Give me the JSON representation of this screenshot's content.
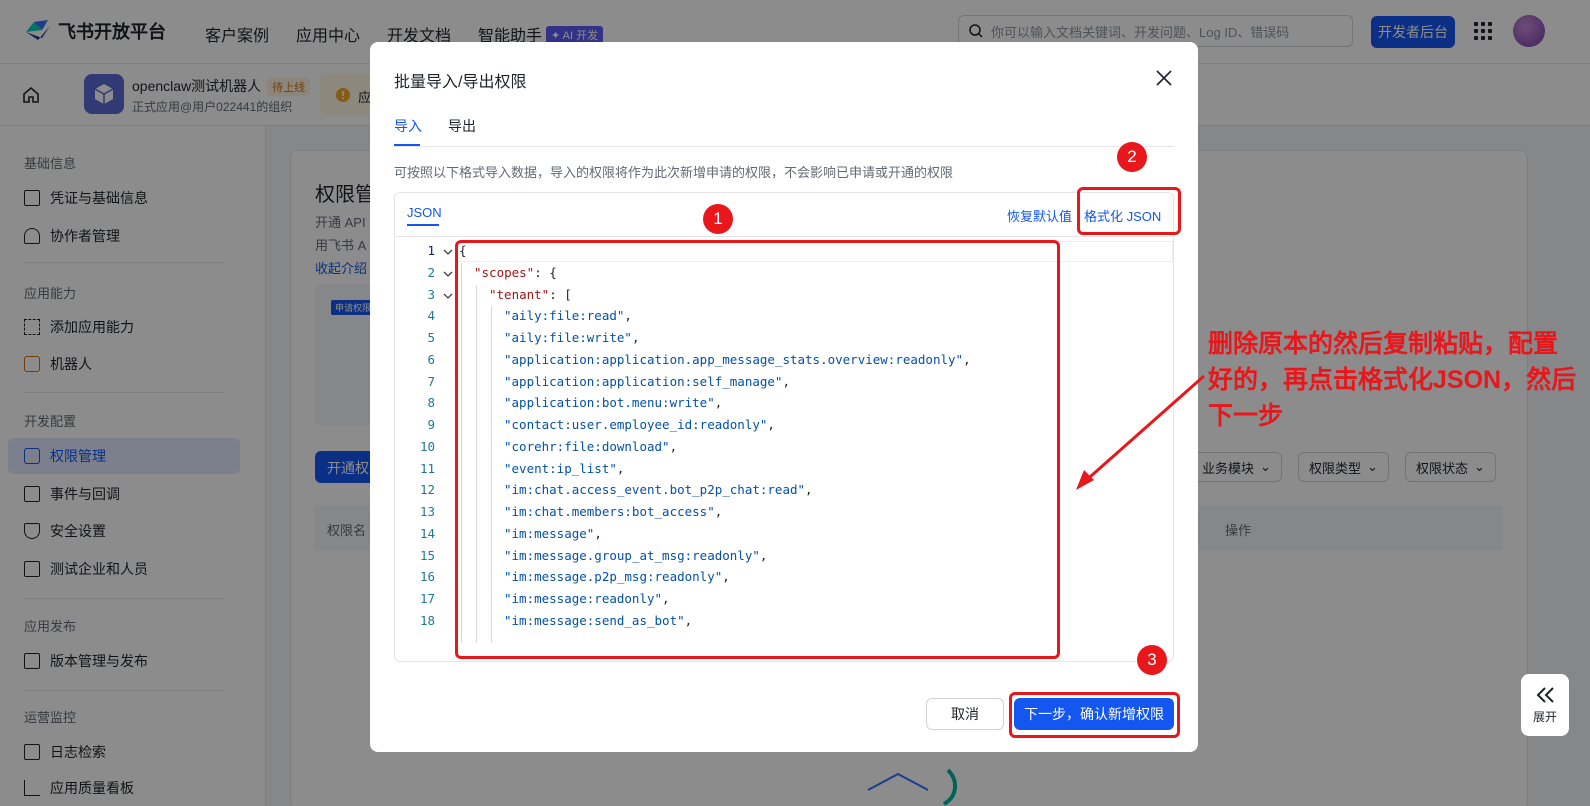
{
  "header": {
    "brand": "飞书开放平台",
    "nav": [
      "客户案例",
      "应用中心",
      "开发文档",
      "智能助手"
    ],
    "ai_badge": "✦ AI 开发",
    "search_placeholder": "你可以输入文档关键词、开发问题、Log ID、错误码",
    "dev_console": "开发者后台"
  },
  "app": {
    "name": "openclaw测试机器人",
    "status_badge": "待上线",
    "org": "正式应用@用户022441的组织",
    "warn_text": "应"
  },
  "sidebar": {
    "sections": [
      {
        "title": "基础信息",
        "items": [
          "凭证与基础信息",
          "协作者管理"
        ]
      },
      {
        "title": "应用能力",
        "items": [
          "添加应用能力",
          "机器人"
        ]
      },
      {
        "title": "开发配置",
        "items": [
          "权限管理",
          "事件与回调",
          "安全设置",
          "测试企业和人员"
        ]
      },
      {
        "title": "应用发布",
        "items": [
          "版本管理与发布"
        ]
      },
      {
        "title": "运营监控",
        "items": [
          "日志检索",
          "应用质量看板"
        ]
      }
    ],
    "active": "权限管理"
  },
  "page": {
    "title": "权限管",
    "desc1": "开通 API",
    "desc2": "用飞书 A",
    "link": "收起介绍",
    "mini_tag": "申请权限",
    "open_btn": "开通权",
    "filters": [
      "业务模块",
      "权限类型",
      "权限状态"
    ],
    "col_name": "权限名",
    "col_action": "操作"
  },
  "modal": {
    "title": "批量导入/导出权限",
    "tabs": [
      "导入",
      "导出"
    ],
    "description": "可按照以下格式导入数据，导入的权限将作为此次新增申请的权限，不会影响已申请或开通的权限",
    "editor_tab": "JSON",
    "restore_default": "恢复默认值",
    "format_json": "格式化 JSON",
    "code_lines": [
      {
        "n": "1",
        "indent": 0,
        "key": "",
        "text": "{"
      },
      {
        "n": "2",
        "indent": 1,
        "key": "\"scopes\"",
        "text": ": {"
      },
      {
        "n": "3",
        "indent": 2,
        "key": "\"tenant\"",
        "text": ": ["
      },
      {
        "n": "4",
        "indent": 3,
        "key": "",
        "val": "\"aily:file:read\"",
        "text": ","
      },
      {
        "n": "5",
        "indent": 3,
        "key": "",
        "val": "\"aily:file:write\"",
        "text": ","
      },
      {
        "n": "6",
        "indent": 3,
        "key": "",
        "val": "\"application:application.app_message_stats.overview:readonly\"",
        "text": ","
      },
      {
        "n": "7",
        "indent": 3,
        "key": "",
        "val": "\"application:application:self_manage\"",
        "text": ","
      },
      {
        "n": "8",
        "indent": 3,
        "key": "",
        "val": "\"application:bot.menu:write\"",
        "text": ","
      },
      {
        "n": "9",
        "indent": 3,
        "key": "",
        "val": "\"contact:user.employee_id:readonly\"",
        "text": ","
      },
      {
        "n": "10",
        "indent": 3,
        "key": "",
        "val": "\"corehr:file:download\"",
        "text": ","
      },
      {
        "n": "11",
        "indent": 3,
        "key": "",
        "val": "\"event:ip_list\"",
        "text": ","
      },
      {
        "n": "12",
        "indent": 3,
        "key": "",
        "val": "\"im:chat.access_event.bot_p2p_chat:read\"",
        "text": ","
      },
      {
        "n": "13",
        "indent": 3,
        "key": "",
        "val": "\"im:chat.members:bot_access\"",
        "text": ","
      },
      {
        "n": "14",
        "indent": 3,
        "key": "",
        "val": "\"im:message\"",
        "text": ","
      },
      {
        "n": "15",
        "indent": 3,
        "key": "",
        "val": "\"im:message.group_at_msg:readonly\"",
        "text": ","
      },
      {
        "n": "16",
        "indent": 3,
        "key": "",
        "val": "\"im:message.p2p_msg:readonly\"",
        "text": ","
      },
      {
        "n": "17",
        "indent": 3,
        "key": "",
        "val": "\"im:message:readonly\"",
        "text": ","
      },
      {
        "n": "18",
        "indent": 3,
        "key": "",
        "val": "\"im:message:send_as_bot\"",
        "text": ","
      }
    ],
    "cancel": "取消",
    "next": "下一步，确认新增权限"
  },
  "annotations": {
    "badges": [
      "1",
      "2",
      "3"
    ],
    "note": "删除原本的然后复制粘贴，配置好的，再点击格式化JSON，然后下一步",
    "accent_color": "#e8171c"
  },
  "expand_label": "展开",
  "colors": {
    "primary": "#1456f0",
    "active_bg": "#e1eaff"
  }
}
